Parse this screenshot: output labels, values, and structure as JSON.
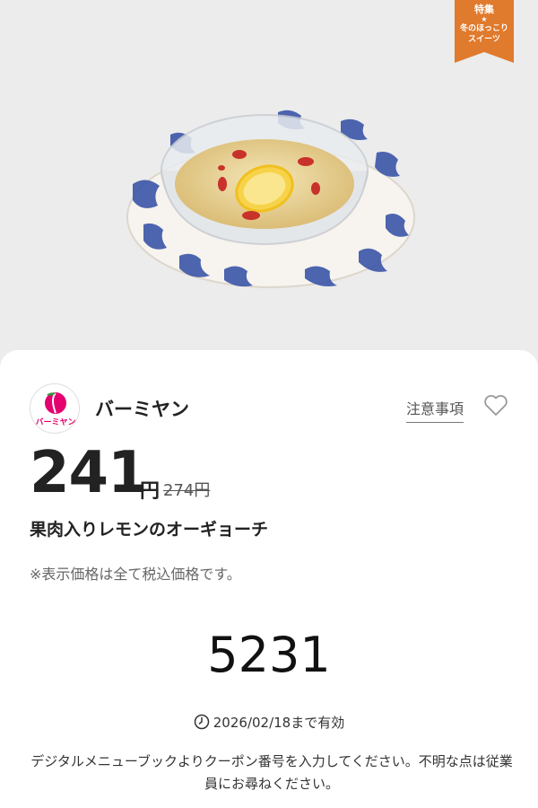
{
  "feature_ribbon": {
    "label": "特集",
    "star": "★",
    "line1": "冬のほっこり",
    "line2": "スイーツ",
    "color": "#e07a2c"
  },
  "hero": {
    "image_icon": "dessert-bowl-image"
  },
  "store": {
    "logo_text": "バーミヤン",
    "name": "バーミヤン",
    "brand_color": "#e4006f"
  },
  "notes_link": "注意事項",
  "favorite_icon": "heart-icon",
  "price": {
    "value": "241",
    "unit": "円",
    "original": "274円"
  },
  "product_name": "果肉入りレモンのオーギョーチ",
  "tax_note": "※表示価格は全て税込価格です。",
  "coupon_code": "5231",
  "validity": {
    "icon": "clock-icon",
    "text": "2026/02/18まで有効"
  },
  "instructions": "デジタルメニューブックよりクーポン番号を入力してください。不明な点は従業員にお尋ねください。"
}
